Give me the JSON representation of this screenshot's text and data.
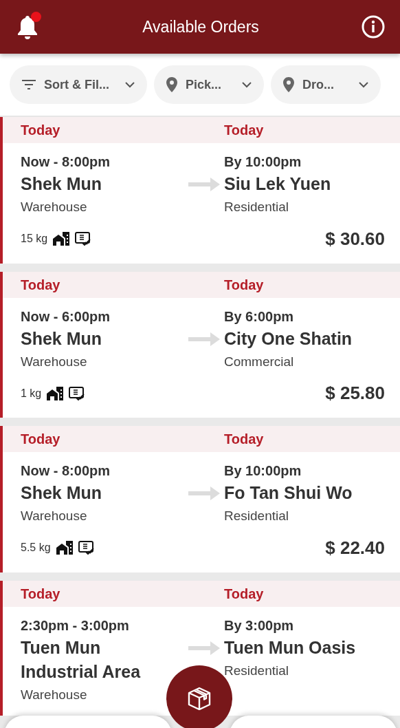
{
  "header": {
    "title": "Available Orders",
    "has_notification": true
  },
  "filters": [
    {
      "kind": "sort",
      "label": "Sort & Fil..."
    },
    {
      "kind": "location",
      "label": "Pick..."
    },
    {
      "kind": "location",
      "label": "Dro..."
    }
  ],
  "orders": [
    {
      "pickup": {
        "date": "Today",
        "time": "Now - 8:00pm",
        "name": "Shek Mun",
        "type": "Warehouse"
      },
      "dropoff": {
        "date": "Today",
        "time": "By 10:00pm",
        "name": "Siu Lek Yuen",
        "type": "Residential"
      },
      "weight": "15 kg",
      "price": "$ 30.60"
    },
    {
      "pickup": {
        "date": "Today",
        "time": "Now - 6:00pm",
        "name": "Shek Mun",
        "type": "Warehouse"
      },
      "dropoff": {
        "date": "Today",
        "time": "By 6:00pm",
        "name": "City One Shatin",
        "type": "Commercial"
      },
      "weight": "1 kg",
      "price": "$ 25.80"
    },
    {
      "pickup": {
        "date": "Today",
        "time": "Now - 8:00pm",
        "name": "Shek Mun",
        "type": "Warehouse"
      },
      "dropoff": {
        "date": "Today",
        "time": "By 10:00pm",
        "name": "Fo Tan Shui Wo",
        "type": "Residential"
      },
      "weight": "5.5 kg",
      "price": "$ 22.40"
    },
    {
      "pickup": {
        "date": "Today",
        "time": "2:30pm - 3:00pm",
        "name": "Tuen Mun Industrial Area",
        "type": "Warehouse"
      },
      "dropoff": {
        "date": "Today",
        "time": "By 3:00pm",
        "name": "Tuen Mun Oasis",
        "type": "Residential"
      }
    }
  ]
}
